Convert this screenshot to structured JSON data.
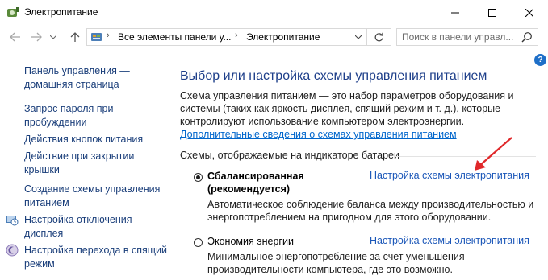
{
  "window": {
    "title": "Электропитание",
    "controls": [
      "minimize",
      "maximize",
      "close"
    ]
  },
  "address_bar": {
    "crumbs": [
      "Все элементы панели у...",
      "Электропитание"
    ],
    "search_placeholder": "Поиск в панели управл..."
  },
  "sidebar": {
    "items": [
      {
        "label": "Панель управления — домашняя страница",
        "icon": ""
      },
      {
        "label": "Запрос пароля при пробуждении",
        "icon": ""
      },
      {
        "label": "Действия кнопок питания",
        "icon": ""
      },
      {
        "label": "Действие при закрытии крышки",
        "icon": ""
      },
      {
        "label": "Создание схемы управления питанием",
        "icon": ""
      },
      {
        "label": "Настройка отключения дисплея",
        "icon": "display-clock-icon"
      },
      {
        "label": "Настройка перехода в спящий режим",
        "icon": "sleep-moon-icon"
      }
    ]
  },
  "main": {
    "title": "Выбор или настройка схемы управления питанием",
    "description": "Схема управления питанием — это набор параметров оборудования и системы (таких как яркость дисплея, спящий режим и т. д.), которые контролируют использование компьютером электроэнергии. ",
    "description_link": "Дополнительные сведения о схемах управления питанием",
    "section_header": "Схемы, отображаемые на индикаторе батареи",
    "plans": [
      {
        "name": "Сбалансированная (рекомендуется)",
        "selected": true,
        "link": "Настройка схемы электропитания",
        "description": "Автоматическое соблюдение баланса между производительностью и энергопотреблением на пригодном для этого оборудовании."
      },
      {
        "name": "Экономия энергии",
        "selected": false,
        "link": "Настройка схемы электропитания",
        "description": "Минимальное энергопотребление за счет уменьшения производительности компьютера, где это возможно."
      }
    ]
  },
  "colors": {
    "link": "#1a56b8",
    "title": "#1e3f8a",
    "annotation_arrow": "#e0282a"
  }
}
